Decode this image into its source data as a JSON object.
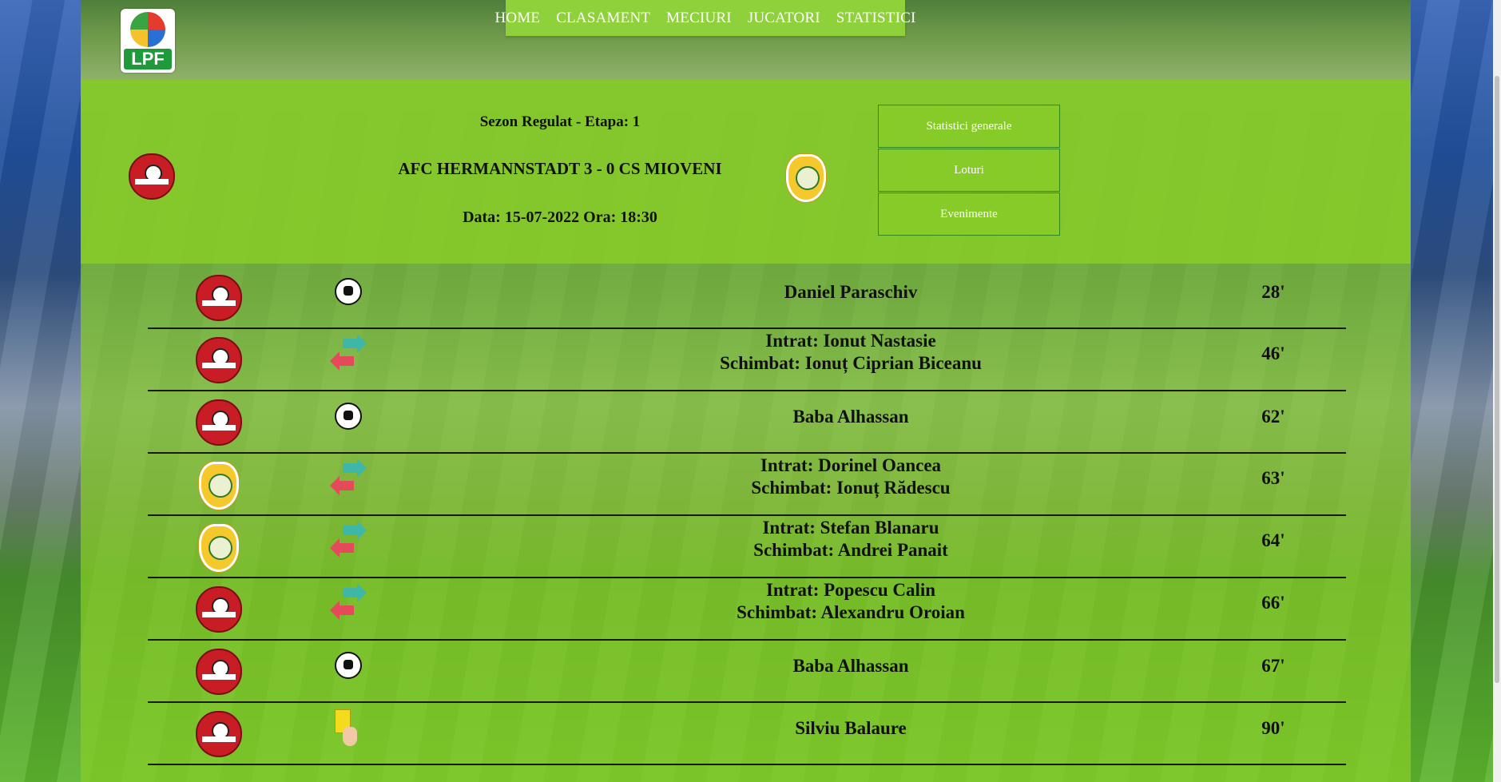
{
  "nav": {
    "items": [
      "HOME",
      "CLASAMENT",
      "MECIURI",
      "JUCATORI",
      "STATISTICI"
    ]
  },
  "logo": {
    "text": "LPF"
  },
  "match": {
    "round": "Sezon Regulat - Etapa: 1",
    "score_line": "AFC HERMANNSTADT 3 - 0 CS MIOVENI",
    "datetime": "Data: 15-07-2022 Ora: 18:30"
  },
  "side_buttons": [
    "Statistici generale",
    "Loturi",
    "Evenimente"
  ],
  "events": [
    {
      "team": "hermannstadt",
      "type": "goal",
      "lines": [
        "Daniel Paraschiv"
      ],
      "minute": "28'"
    },
    {
      "team": "hermannstadt",
      "type": "substitution",
      "lines": [
        "Intrat: Ionut Nastasie",
        "Schimbat: Ionuț Ciprian Biceanu"
      ],
      "minute": "46'"
    },
    {
      "team": "hermannstadt",
      "type": "goal",
      "lines": [
        "Baba Alhassan"
      ],
      "minute": "62'"
    },
    {
      "team": "mioveni",
      "type": "substitution",
      "lines": [
        "Intrat: Dorinel Oancea",
        "Schimbat: Ionuț Rădescu"
      ],
      "minute": "63'"
    },
    {
      "team": "mioveni",
      "type": "substitution",
      "lines": [
        "Intrat: Stefan Blanaru",
        "Schimbat: Andrei Panait"
      ],
      "minute": "64'"
    },
    {
      "team": "hermannstadt",
      "type": "substitution",
      "lines": [
        "Intrat: Popescu Calin",
        "Schimbat: Alexandru Oroian"
      ],
      "minute": "66'"
    },
    {
      "team": "hermannstadt",
      "type": "goal",
      "lines": [
        "Baba Alhassan"
      ],
      "minute": "67'"
    },
    {
      "team": "hermannstadt",
      "type": "yellow-card",
      "lines": [
        "Silviu Balaure"
      ],
      "minute": "90'"
    }
  ]
}
